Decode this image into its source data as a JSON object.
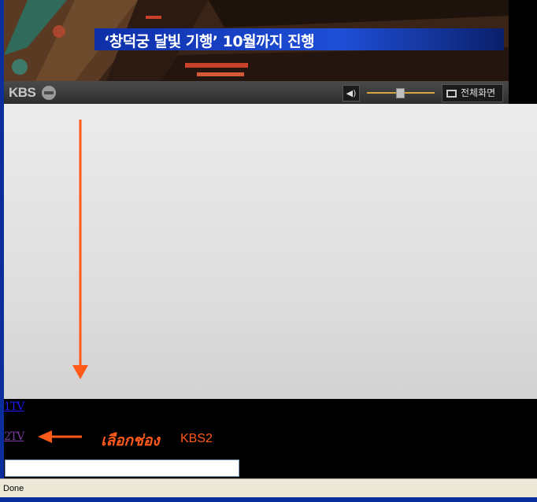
{
  "video": {
    "caption": "‘창덕궁 달빛 기행’ 10월까지 진행"
  },
  "player": {
    "logo": "KBS",
    "mute_icon": "speaker-icon",
    "volume_level_percent": 50,
    "fullscreen_label": "전체화면"
  },
  "links": {
    "tv1": "1TV",
    "tv2": "2TV"
  },
  "annotation": {
    "thai_text": "เลือกช่อง",
    "channel": "KBS2",
    "color": "#ff5a1a"
  },
  "input": {
    "value": ""
  },
  "status": {
    "text": "Done"
  }
}
